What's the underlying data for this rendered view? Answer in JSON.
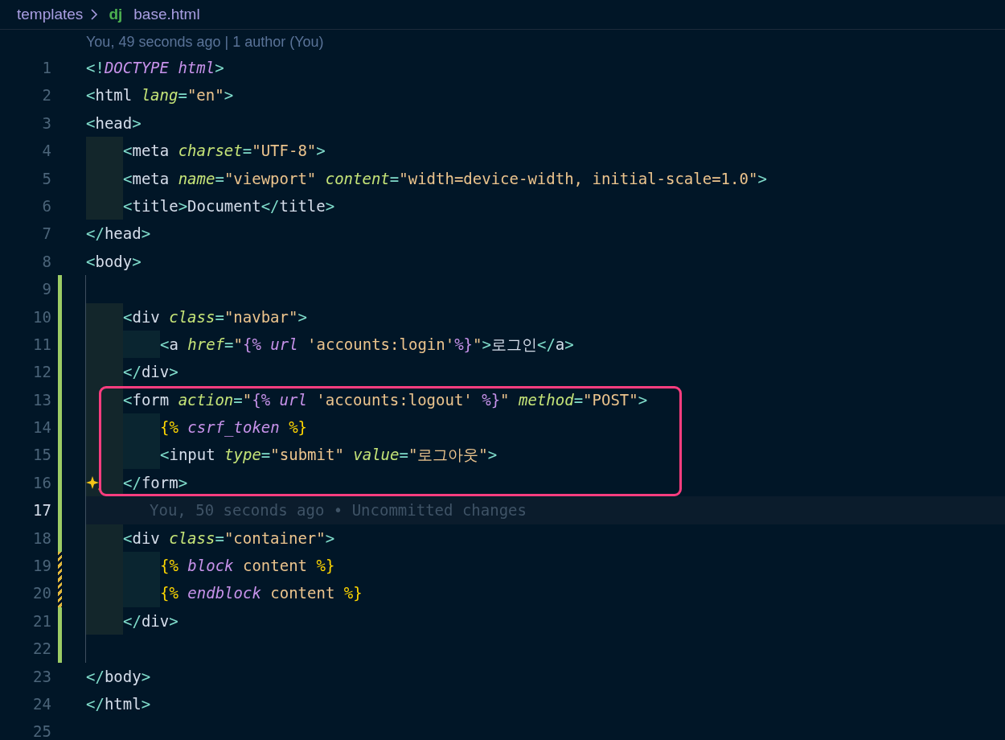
{
  "breadcrumb": {
    "folder": "templates",
    "file_icon": "dj",
    "file": "base.html"
  },
  "codelens": "You, 49 seconds ago | 1 author (You)",
  "lines": [
    {
      "number": "1",
      "tokens": [
        {
          "kind": "p",
          "text": "<!"
        },
        {
          "kind": "k",
          "text": "DOCTYPE html"
        },
        {
          "kind": "p",
          "text": ">"
        }
      ]
    },
    {
      "number": "2",
      "tokens": [
        {
          "kind": "p",
          "text": "<"
        },
        {
          "kind": "t",
          "text": "html "
        },
        {
          "kind": "a",
          "text": "lang"
        },
        {
          "kind": "p",
          "text": "="
        },
        {
          "kind": "s",
          "text": "\"en\""
        },
        {
          "kind": "p",
          "text": ">"
        }
      ]
    },
    {
      "number": "3",
      "tokens": [
        {
          "kind": "p",
          "text": "<"
        },
        {
          "kind": "t",
          "text": "head"
        },
        {
          "kind": "p",
          "text": ">"
        }
      ]
    },
    {
      "number": "4",
      "indent": [
        {
          "kind": "outer"
        }
      ],
      "tokens": [
        {
          "kind": "p",
          "text": "<"
        },
        {
          "kind": "t",
          "text": "meta "
        },
        {
          "kind": "a",
          "text": "charset"
        },
        {
          "kind": "p",
          "text": "="
        },
        {
          "kind": "s",
          "text": "\"UTF-8\""
        },
        {
          "kind": "p",
          "text": ">"
        }
      ]
    },
    {
      "number": "5",
      "indent": [
        {
          "kind": "outer"
        }
      ],
      "tokens": [
        {
          "kind": "p",
          "text": "<"
        },
        {
          "kind": "t",
          "text": "meta "
        },
        {
          "kind": "a",
          "text": "name"
        },
        {
          "kind": "p",
          "text": "="
        },
        {
          "kind": "s",
          "text": "\"viewport\" "
        },
        {
          "kind": "a",
          "text": "content"
        },
        {
          "kind": "p",
          "text": "="
        },
        {
          "kind": "s",
          "text": "\"width=device-width, initial-scale=1.0\""
        },
        {
          "kind": "p",
          "text": ">"
        }
      ]
    },
    {
      "number": "6",
      "indent": [
        {
          "kind": "outer"
        }
      ],
      "tokens": [
        {
          "kind": "p",
          "text": "<"
        },
        {
          "kind": "t",
          "text": "title"
        },
        {
          "kind": "p",
          "text": ">"
        },
        {
          "kind": "t",
          "text": "Document"
        },
        {
          "kind": "p",
          "text": "</"
        },
        {
          "kind": "t",
          "text": "title"
        },
        {
          "kind": "p",
          "text": ">"
        }
      ]
    },
    {
      "number": "7",
      "tokens": [
        {
          "kind": "p",
          "text": "</"
        },
        {
          "kind": "t",
          "text": "head"
        },
        {
          "kind": "p",
          "text": ">"
        }
      ]
    },
    {
      "number": "8",
      "tokens": [
        {
          "kind": "p",
          "text": "<"
        },
        {
          "kind": "t",
          "text": "body"
        },
        {
          "kind": "p",
          "text": ">"
        }
      ]
    },
    {
      "number": "9",
      "added": true,
      "guide": true
    },
    {
      "number": "10",
      "added": true,
      "guide": true,
      "indent": [
        {
          "kind": "outer"
        }
      ],
      "tokens": [
        {
          "kind": "p",
          "text": "<"
        },
        {
          "kind": "t",
          "text": "div "
        },
        {
          "kind": "a",
          "text": "class"
        },
        {
          "kind": "p",
          "text": "="
        },
        {
          "kind": "s",
          "text": "\"navbar\""
        },
        {
          "kind": "p",
          "text": ">"
        }
      ]
    },
    {
      "number": "11",
      "added": true,
      "guide": true,
      "indent": [
        {
          "kind": "outer"
        },
        {
          "kind": "inner"
        }
      ],
      "tokens": [
        {
          "kind": "p",
          "text": "<"
        },
        {
          "kind": "t",
          "text": "a "
        },
        {
          "kind": "a",
          "text": "href"
        },
        {
          "kind": "p",
          "text": "="
        },
        {
          "kind": "s",
          "text": "\""
        },
        {
          "kind": "m",
          "text": "{% "
        },
        {
          "kind": "k",
          "text": "url"
        },
        {
          "kind": "s",
          "text": " 'accounts:login'"
        },
        {
          "kind": "m",
          "text": "%}"
        },
        {
          "kind": "s",
          "text": "\""
        },
        {
          "kind": "p",
          "text": ">"
        },
        {
          "kind": "t",
          "text": "로그인"
        },
        {
          "kind": "p",
          "text": "</"
        },
        {
          "kind": "t",
          "text": "a"
        },
        {
          "kind": "p",
          "text": ">"
        }
      ]
    },
    {
      "number": "12",
      "added": true,
      "guide": true,
      "indent": [
        {
          "kind": "outer"
        }
      ],
      "tokens": [
        {
          "kind": "p",
          "text": "</"
        },
        {
          "kind": "t",
          "text": "div"
        },
        {
          "kind": "p",
          "text": ">"
        }
      ]
    },
    {
      "number": "13",
      "added": true,
      "guide": true,
      "highlighted": true,
      "indent": [
        {
          "kind": "outer"
        }
      ],
      "tokens": [
        {
          "kind": "p",
          "text": "<"
        },
        {
          "kind": "t",
          "text": "form "
        },
        {
          "kind": "a",
          "text": "action"
        },
        {
          "kind": "p",
          "text": "="
        },
        {
          "kind": "s",
          "text": "\""
        },
        {
          "kind": "m",
          "text": "{% "
        },
        {
          "kind": "k",
          "text": "url"
        },
        {
          "kind": "s",
          "text": " 'accounts:logout' "
        },
        {
          "kind": "m",
          "text": "%}"
        },
        {
          "kind": "s",
          "text": "\" "
        },
        {
          "kind": "a",
          "text": "method"
        },
        {
          "kind": "p",
          "text": "="
        },
        {
          "kind": "s",
          "text": "\"POST\""
        },
        {
          "kind": "p",
          "text": ">"
        }
      ]
    },
    {
      "number": "14",
      "added": true,
      "guide": true,
      "highlighted": true,
      "indent": [
        {
          "kind": "outer"
        },
        {
          "kind": "inner"
        }
      ],
      "tokens": [
        {
          "kind": "d",
          "text": "{% "
        },
        {
          "kind": "k",
          "text": "csrf_token"
        },
        {
          "kind": "d",
          "text": " %}"
        }
      ]
    },
    {
      "number": "15",
      "added": true,
      "guide": true,
      "highlighted": true,
      "indent": [
        {
          "kind": "outer"
        },
        {
          "kind": "inner"
        }
      ],
      "tokens": [
        {
          "kind": "p",
          "text": "<"
        },
        {
          "kind": "t",
          "text": "input "
        },
        {
          "kind": "a",
          "text": "type"
        },
        {
          "kind": "p",
          "text": "="
        },
        {
          "kind": "s",
          "text": "\"submit\" "
        },
        {
          "kind": "a",
          "text": "value"
        },
        {
          "kind": "p",
          "text": "="
        },
        {
          "kind": "s",
          "text": "\"로그아웃\""
        },
        {
          "kind": "p",
          "text": ">"
        }
      ]
    },
    {
      "number": "16",
      "added": true,
      "guide": true,
      "highlighted": true,
      "sparkle": true,
      "indent": [
        {
          "kind": "outer"
        }
      ],
      "tokens": [
        {
          "kind": "p",
          "text": "</"
        },
        {
          "kind": "t",
          "text": "form"
        },
        {
          "kind": "p",
          "text": ">"
        }
      ]
    },
    {
      "number": "17",
      "added": true,
      "guide": true,
      "current": true,
      "blame": "You, 50 seconds ago • Uncommitted changes"
    },
    {
      "number": "18",
      "added": true,
      "guide": true,
      "indent": [
        {
          "kind": "outer"
        }
      ],
      "tokens": [
        {
          "kind": "p",
          "text": "<"
        },
        {
          "kind": "t",
          "text": "div "
        },
        {
          "kind": "a",
          "text": "class"
        },
        {
          "kind": "p",
          "text": "="
        },
        {
          "kind": "s",
          "text": "\"container\""
        },
        {
          "kind": "p",
          "text": ">"
        }
      ]
    },
    {
      "number": "19",
      "modified": true,
      "guide": true,
      "indent": [
        {
          "kind": "outer"
        },
        {
          "kind": "inner"
        }
      ],
      "tokens": [
        {
          "kind": "d",
          "text": "{% "
        },
        {
          "kind": "k",
          "text": "block"
        },
        {
          "kind": "s",
          "text": " content "
        },
        {
          "kind": "d",
          "text": "%}"
        }
      ]
    },
    {
      "number": "20",
      "modified": true,
      "guide": true,
      "indent": [
        {
          "kind": "outer"
        },
        {
          "kind": "inner"
        }
      ],
      "tokens": [
        {
          "kind": "d",
          "text": "{% "
        },
        {
          "kind": "k",
          "text": "endblock"
        },
        {
          "kind": "s",
          "text": " content "
        },
        {
          "kind": "d",
          "text": "%}"
        }
      ]
    },
    {
      "number": "21",
      "added": true,
      "guide": true,
      "indent": [
        {
          "kind": "outer"
        }
      ],
      "tokens": [
        {
          "kind": "p",
          "text": "</"
        },
        {
          "kind": "t",
          "text": "div"
        },
        {
          "kind": "p",
          "text": ">"
        }
      ]
    },
    {
      "number": "22",
      "added": true,
      "guide": true
    },
    {
      "number": "23",
      "tokens": [
        {
          "kind": "p",
          "text": "</"
        },
        {
          "kind": "t",
          "text": "body"
        },
        {
          "kind": "p",
          "text": ">"
        }
      ]
    },
    {
      "number": "24",
      "tokens": [
        {
          "kind": "p",
          "text": "</"
        },
        {
          "kind": "t",
          "text": "html"
        },
        {
          "kind": "p",
          "text": ">"
        }
      ]
    },
    {
      "number": "25"
    }
  ]
}
